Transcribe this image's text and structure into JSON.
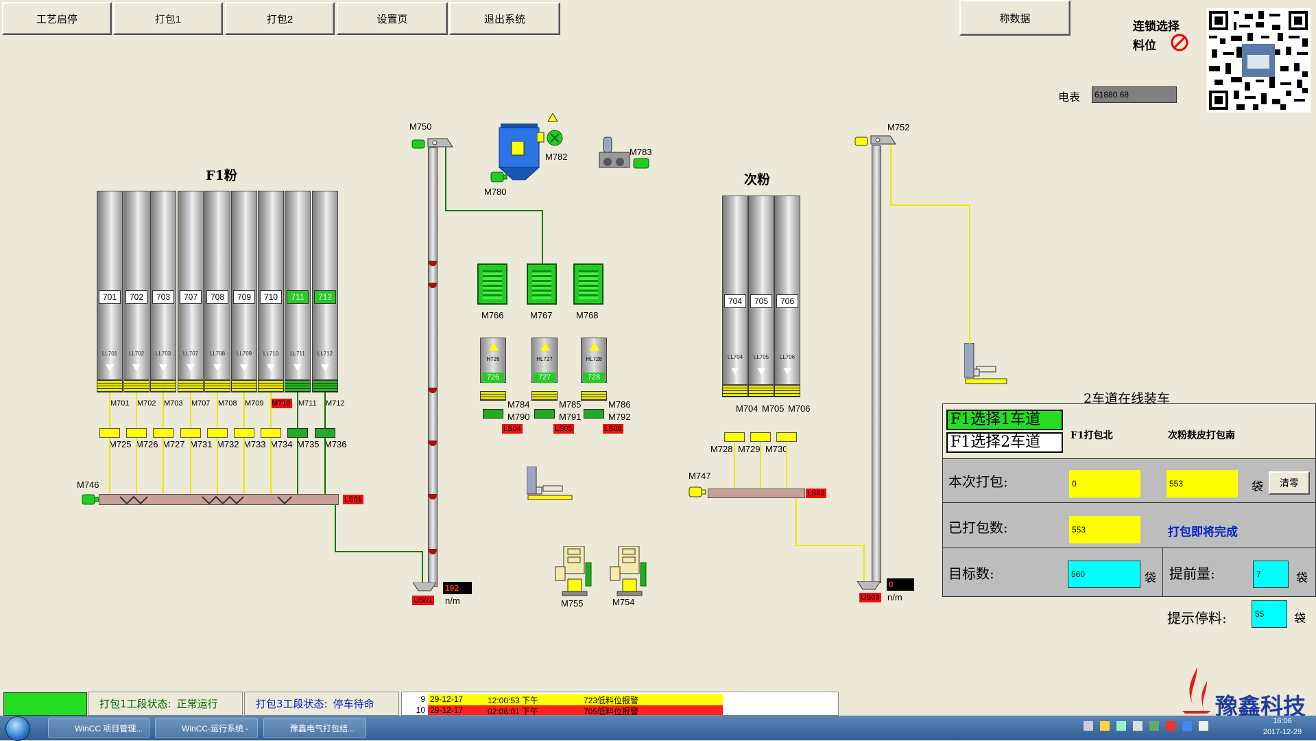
{
  "menu": {
    "start_stop": "工艺启停",
    "pack1": "打包1",
    "pack2": "打包2",
    "settings": "设置页",
    "exit": "退出系统",
    "weigh_data": "称数据"
  },
  "interlock": {
    "label1": "连锁选择",
    "label2": "料位"
  },
  "meter": {
    "label": "电表",
    "value": "61880.68"
  },
  "f1": {
    "title": "F1粉",
    "silos": [
      "701",
      "702",
      "703",
      "707",
      "708",
      "709",
      "710",
      "711",
      "712"
    ],
    "ll": [
      "LL701",
      "LL702",
      "LL703",
      "LL707",
      "LL708",
      "LL709",
      "LL710",
      "LL711",
      "LL712"
    ],
    "feeders": [
      "M701",
      "M702",
      "M703",
      "M707",
      "M708",
      "M709",
      "M710",
      "M711",
      "M712"
    ],
    "gates": [
      "M725",
      "M726",
      "M727",
      "M731",
      "M732",
      "M733",
      "M734",
      "M735",
      "M736"
    ],
    "screw": "M746",
    "ls": "LS01"
  },
  "elevator1": {
    "motor": "M750",
    "ls": "US01",
    "speed": "192",
    "unit": "n/m"
  },
  "top_equip": {
    "m780": "M780",
    "m782": "M782",
    "m783": "M783"
  },
  "bays": [
    "M766",
    "M767",
    "M768"
  ],
  "hoppers": {
    "tags": [
      "H726",
      "HL727",
      "HL728"
    ],
    "nums": [
      "726",
      "727",
      "728"
    ],
    "motors_a": [
      "M784",
      "M785",
      "M786"
    ],
    "motors_b": [
      "M790",
      "M791",
      "M792"
    ],
    "ls": [
      "LS04",
      "LS05",
      "LS06"
    ]
  },
  "packers": [
    "M755",
    "M754"
  ],
  "cifen": {
    "title": "次粉",
    "silos": [
      "704",
      "705",
      "706"
    ],
    "ll": [
      "LL704",
      "LL705",
      "LL706"
    ],
    "feeders": [
      "M704",
      "M705",
      "M706"
    ],
    "gates": [
      "M728",
      "M729",
      "M730"
    ],
    "screw": "M747",
    "ls": "LS02"
  },
  "elevator2": {
    "motor": "M752",
    "ls": "US03",
    "speed": "0",
    "unit": "n/m"
  },
  "panel": {
    "heading": "2车道在线装车",
    "lane1": "F1选择1车道",
    "lane2": "F1选择2车道",
    "col1": "F1打包北",
    "col2": "次粉麸皮打包南",
    "this_pack_label": "本次打包:",
    "this_pack_v1": "0",
    "this_pack_v2": "553",
    "unit_bag": "袋",
    "clear": "清零",
    "packed_label": "已打包数:",
    "packed_v": "553",
    "almost_done": "打包即将完成",
    "target_label": "目标数:",
    "target_v": "560",
    "advance_label": "提前量:",
    "advance_v": "7",
    "stop_label": "提示停料:",
    "stop_v": "55"
  },
  "status": {
    "s1_label": "打包1工段状态:",
    "s1_value": "正常运行",
    "s3_label": "打包3工段状态:",
    "s3_value": "停车待命"
  },
  "alarms": [
    {
      "n": "9",
      "date": "29-12-17",
      "time": "12:00:53 下午",
      "msg": "723低料位报警",
      "color": "#ffff00"
    },
    {
      "n": "10",
      "date": "29-12-17",
      "time": "02:06:01 下午",
      "msg": "705低料位报警",
      "color": "#ff2222"
    }
  ],
  "logo": "豫鑫科技",
  "taskbar": {
    "t1": "WinCC 项目管理...",
    "t2": "WinCC-运行系统 -",
    "t3": "豫鑫电气打包结...",
    "time": "16:06",
    "date": "2017-12-29"
  }
}
